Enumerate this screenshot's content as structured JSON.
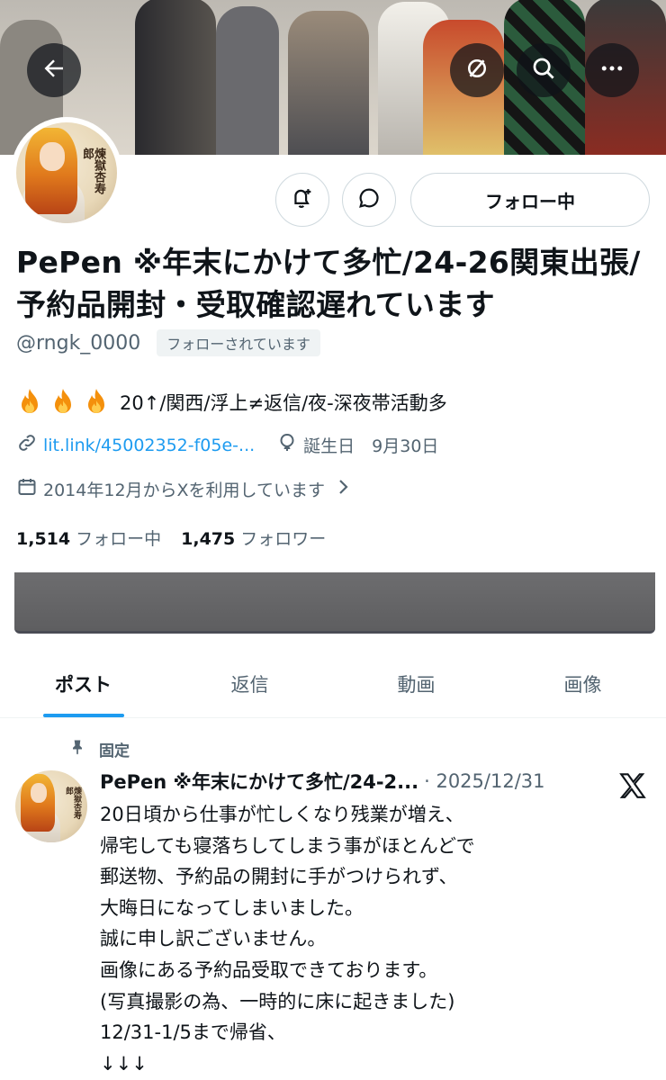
{
  "header": {
    "back_icon": "arrow-left-icon",
    "translate_icon": "no-sign-icon",
    "search_icon": "search-icon",
    "more_icon": "more-horizontal-icon"
  },
  "profile": {
    "avatar_text": "煉獄杏寿郎",
    "follow_button": "フォロー中",
    "name": "PePen ※年末にかけて多忙/24-26関東出張/予約品開封・受取確認遅れています",
    "handle": "@rngk_0000",
    "follows_you": "フォローされています",
    "bio_text": "20↑/関西/浮上≠返信/夜-深夜帯活動多",
    "link": "lit.link/45002352-f05e-...",
    "birthday": "誕生日　9月30日",
    "joined": "2014年12月からXを利用しています",
    "following_count": "1,514",
    "following_label": "フォロー中",
    "followers_count": "1,475",
    "followers_label": "フォロワー"
  },
  "tabs": [
    {
      "label": "ポスト",
      "active": true
    },
    {
      "label": "返信",
      "active": false
    },
    {
      "label": "動画",
      "active": false
    },
    {
      "label": "画像",
      "active": false
    }
  ],
  "post": {
    "pinned_label": "固定",
    "author": "PePen ※年末にかけて多忙/24-2...",
    "date": "· 2025/12/31",
    "text": "20日頃から仕事が忙しくなり残業が増え、\n帰宅しても寝落ちしてしまう事がほとんどで\n郵送物、予約品の開封に手がつけられず、\n大晦日になってしまいました。\n誠に申し訳ございません。\n画像にある予約品受取できております。\n(写真撮影の為、一時的に床に起きました)\n12/31-1/5まで帰省、\n↓↓↓"
  },
  "colors": {
    "accent": "#1d9bf0",
    "text": "#0f1419",
    "secondary": "#536471"
  }
}
